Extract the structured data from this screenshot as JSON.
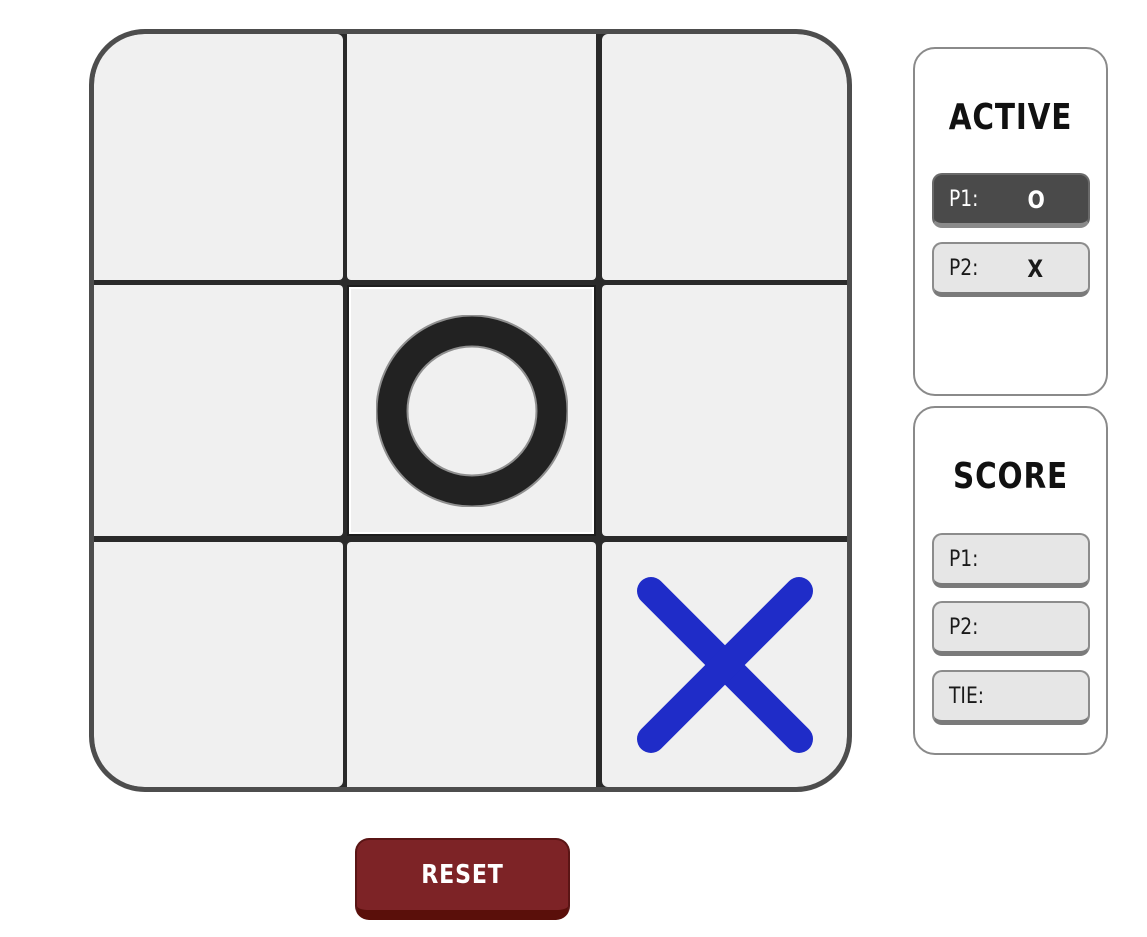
{
  "board": {
    "cells": [
      {
        "row": 0,
        "col": 0,
        "mark": ""
      },
      {
        "row": 0,
        "col": 1,
        "mark": ""
      },
      {
        "row": 0,
        "col": 2,
        "mark": ""
      },
      {
        "row": 1,
        "col": 0,
        "mark": ""
      },
      {
        "row": 1,
        "col": 1,
        "mark": "O"
      },
      {
        "row": 1,
        "col": 2,
        "mark": ""
      },
      {
        "row": 2,
        "col": 0,
        "mark": ""
      },
      {
        "row": 2,
        "col": 1,
        "mark": ""
      },
      {
        "row": 2,
        "col": 2,
        "mark": "X"
      }
    ],
    "highlighted_cell": {
      "row": 1,
      "col": 1
    },
    "colors": {
      "o_mark": "#222222",
      "x_mark": "#1f2cc8",
      "cell_bg": "#f0f0f0",
      "grid": "#2a2a2a"
    }
  },
  "active": {
    "title": "ACTIVE",
    "players": [
      {
        "label": "P1:",
        "symbol": "O",
        "is_active": true
      },
      {
        "label": "P2:",
        "symbol": "X",
        "is_active": false
      }
    ]
  },
  "score": {
    "title": "SCORE",
    "rows": [
      {
        "label": "P1:",
        "value": ""
      },
      {
        "label": "P2:",
        "value": ""
      },
      {
        "label": "TIE:",
        "value": ""
      }
    ]
  },
  "reset": {
    "label": "RESET",
    "color": "#7d2326"
  }
}
